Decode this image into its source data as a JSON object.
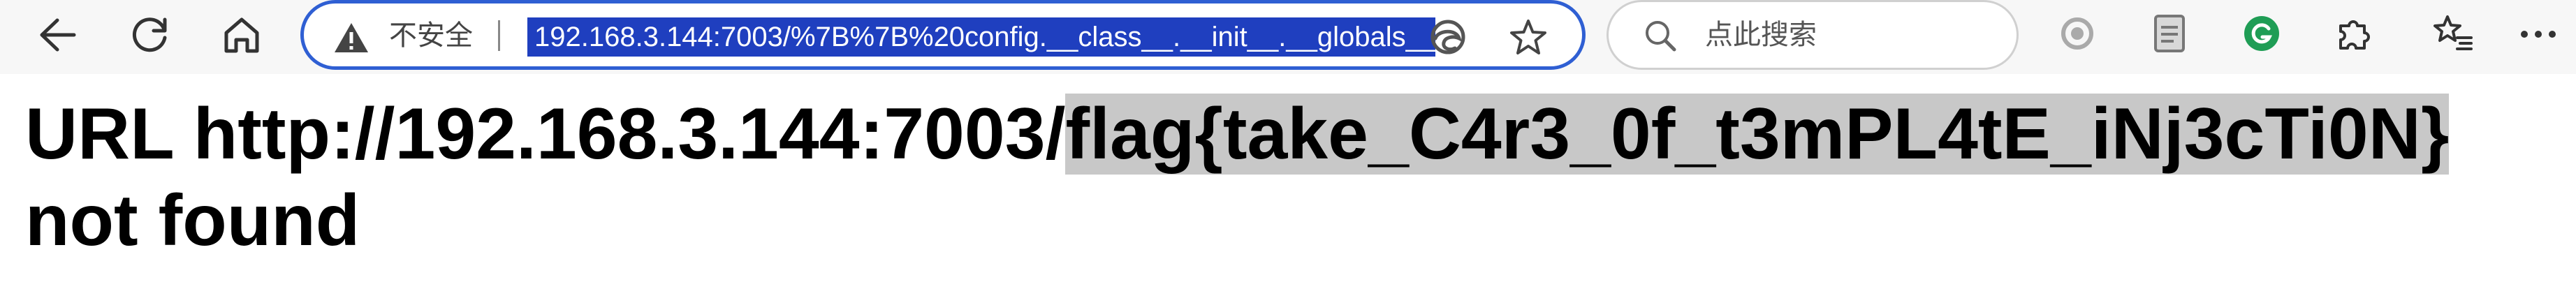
{
  "browser": {
    "security_label": "不安全",
    "url": "192.168.3.144:7003/%7B%7B%20config.__class__.__init__.__globals__",
    "search_placeholder": "点此搜索",
    "colors": {
      "address_border": "#2f5fd3",
      "url_selection": "#1f3fbf",
      "extension_green": "#1f9d55"
    },
    "icons": {
      "back": "arrow-left",
      "reload": "circular-arrow",
      "home": "house",
      "warning": "triangle-exclamation",
      "edge": "edge-logo",
      "favorite": "star",
      "search": "magnifier",
      "ext1": "grey-circle",
      "ext2": "document",
      "ext3": "grammarly-g",
      "extensions": "puzzle-piece",
      "favorites": "star-list",
      "more": "ellipsis"
    }
  },
  "page": {
    "heading_prefix": "URL http://192.168.3.144:7003/",
    "heading_flag": "flag{take_C4r3_0f_t3mPL4tE_iNj3cTi0N}",
    "heading_suffix": " not found"
  }
}
